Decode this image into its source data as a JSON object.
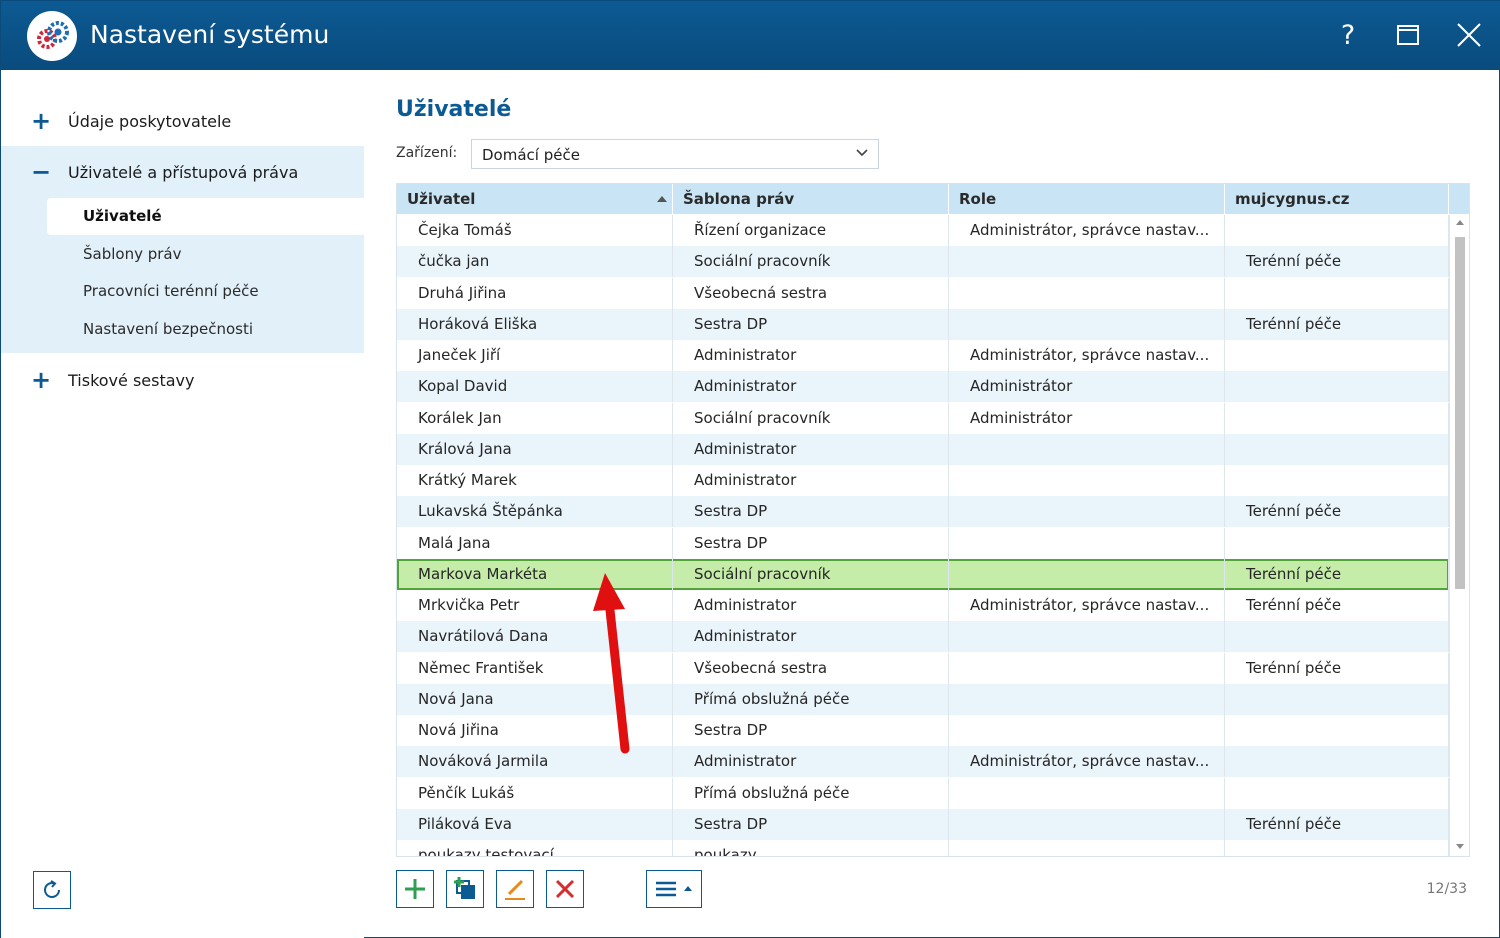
{
  "window": {
    "title": "Nastavení systému"
  },
  "titlebar": {
    "help_label": "?",
    "maximize_label": "□",
    "close_label": "✕"
  },
  "sidebar": {
    "sections": [
      {
        "sign": "+",
        "label": "Údaje poskytovatele",
        "expanded": false
      },
      {
        "sign": "−",
        "label": "Uživatelé a přístupová práva",
        "expanded": true
      },
      {
        "sign": "+",
        "label": "Tiskové sestavy",
        "expanded": false
      }
    ],
    "sub_items": [
      {
        "label": "Uživatelé",
        "active": true
      },
      {
        "label": "Šablony práv",
        "active": false
      },
      {
        "label": "Pracovníci terénní péče",
        "active": false
      },
      {
        "label": "Nastavení bezpečnosti",
        "active": false
      }
    ]
  },
  "main": {
    "title": "Uživatelé",
    "filter": {
      "label": "Zařízení:",
      "value": "Domácí péče"
    }
  },
  "grid": {
    "columns": [
      {
        "label": "Uživatel"
      },
      {
        "label": "Šablona práv"
      },
      {
        "label": "Role"
      },
      {
        "label": "mujcygnus.cz"
      }
    ],
    "sorted_column": "Uživatel",
    "sort_direction": "ascending",
    "rows": [
      [
        "Čejka Tomáš",
        "Řízení organizace",
        "Administrátor, správce nastav...",
        ""
      ],
      [
        "čučka jan",
        "Sociální pracovník",
        "",
        "Terénní péče"
      ],
      [
        "Druhá Jiřina",
        "Všeobecná sestra",
        "",
        ""
      ],
      [
        "Horáková Eliška",
        "Sestra DP",
        "",
        "Terénní péče"
      ],
      [
        "Janeček Jiří",
        "Administrator",
        "Administrátor, správce nastav...",
        ""
      ],
      [
        "Kopal David",
        "Administrator",
        "Administrátor",
        ""
      ],
      [
        "Korálek Jan",
        "Sociální pracovník",
        "Administrátor",
        ""
      ],
      [
        "Králová Jana",
        "Administrator",
        "",
        ""
      ],
      [
        "Krátký Marek",
        "Administrator",
        "",
        ""
      ],
      [
        "Lukavská Štěpánka",
        "Sestra DP",
        "",
        "Terénní péče"
      ],
      [
        "Malá Jana",
        "Sestra DP",
        "",
        ""
      ],
      [
        "Markova Markéta",
        "Sociální pracovník",
        "",
        "Terénní péče"
      ],
      [
        "Mrkvička Petr",
        "Administrator",
        "Administrátor, správce nastav...",
        "Terénní péče"
      ],
      [
        "Navrátilová Dana",
        "Administrator",
        "",
        ""
      ],
      [
        "Němec František",
        "Všeobecná sestra",
        "",
        "Terénní péče"
      ],
      [
        "Nová Jana",
        "Přímá obslužná péče",
        "",
        ""
      ],
      [
        "Nová Jiřina",
        "Sestra DP",
        "",
        ""
      ],
      [
        "Nováková Jarmila",
        "Administrator",
        "Administrátor, správce nastav...",
        ""
      ],
      [
        "Pěnčík Lukáš",
        "Přímá obslužná péče",
        "",
        ""
      ],
      [
        "Piláková Eva",
        "Sestra DP",
        "",
        "Terénní péče"
      ],
      [
        "poukazy testovací",
        "poukazy",
        "",
        ""
      ]
    ],
    "selected_row_index": 11
  },
  "footer": {
    "counter": "12/33"
  },
  "colors": {
    "accent": "#0c5a93",
    "header_bg": "#c9e4f4",
    "sidebar_bg": "#e2f0f9",
    "selected_row": "#c5eda9",
    "delete_red": "#d32f2f",
    "add_green": "#2e9e4f",
    "annotation_arrow": "#e01010"
  },
  "icons": [
    "app-gears-icon",
    "help-icon",
    "maximize-icon",
    "close-icon",
    "chevron-down-icon",
    "sort-ascending-icon",
    "refresh-icon",
    "add-icon",
    "copy-add-icon",
    "edit-icon",
    "delete-icon",
    "menu-icon"
  ]
}
